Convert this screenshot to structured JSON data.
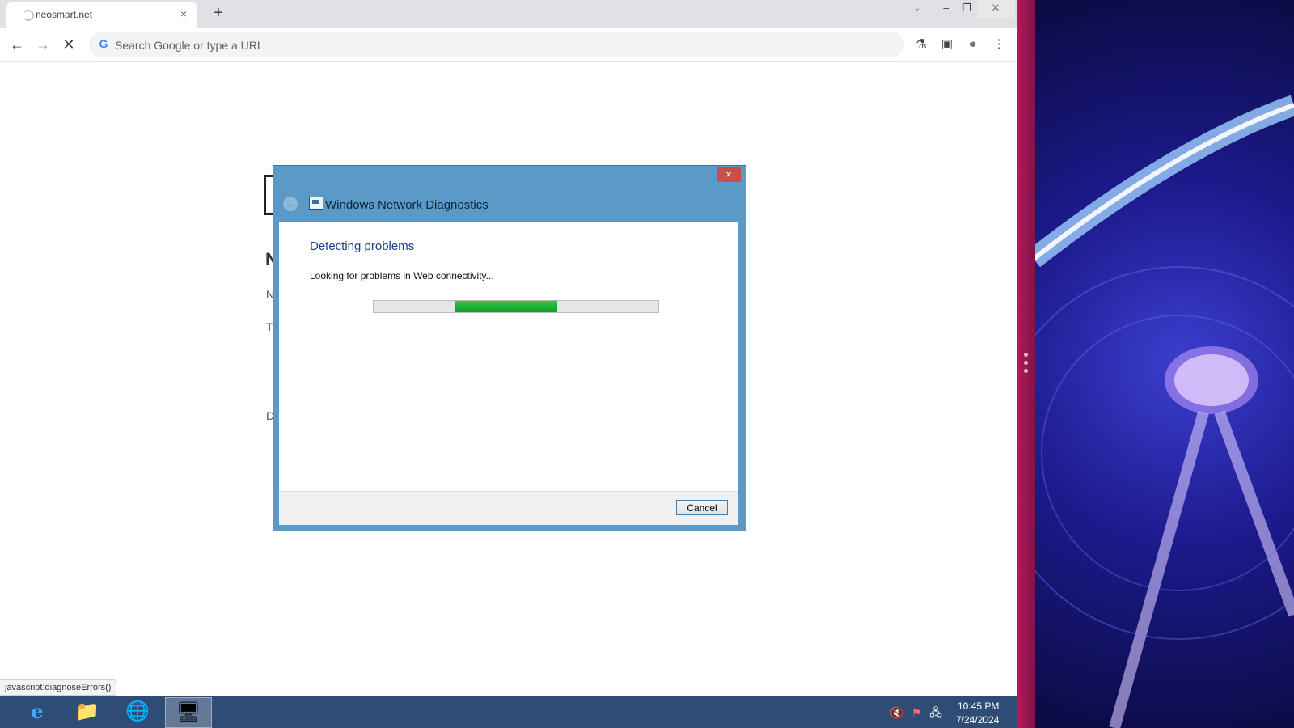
{
  "browser": {
    "tab": {
      "title": "neosmart.net",
      "close_icon": "×"
    },
    "new_tab": "+",
    "window_controls": {
      "tab_list": "⌄",
      "minimize": "–",
      "restore": "❐",
      "close": "✕"
    },
    "nav": {
      "back": "←",
      "forward": "→",
      "stop": "✕"
    },
    "omnibox": {
      "placeholder": "Search Google or type a URL",
      "g_icon": "G"
    },
    "toolbar_icons": {
      "labs": "⚗",
      "side_panel": "▣",
      "profile": "●",
      "menu": "⋮"
    },
    "status_bubble": "javascript:diagnoseErrors()",
    "page_fragments": [
      "N",
      "N",
      "T",
      "D"
    ]
  },
  "dialog": {
    "title": "Windows Network Diagnostics",
    "close_icon": "×",
    "back_icon": "←",
    "heading": "Detecting problems",
    "status": "Looking for problems in Web connectivity...",
    "progress_position": "indeterminate (marquee)",
    "cancel_label": "Cancel"
  },
  "taskbar": {
    "apps": [
      {
        "name": "Internet Explorer",
        "icon": "internet-explorer-icon",
        "glyph": "e"
      },
      {
        "name": "File Explorer",
        "icon": "folder-icon",
        "glyph": "📁"
      },
      {
        "name": "Network",
        "icon": "globe-icon",
        "glyph": "🌐"
      },
      {
        "name": "Network Diagnostics",
        "icon": "diagnostics-icon",
        "glyph": "🖥"
      }
    ],
    "tray": {
      "volume": "🔇",
      "flag": "⚑",
      "network": "🖧"
    },
    "clock": {
      "time": "10:45 PM",
      "date": "7/24/2024"
    }
  },
  "colors": {
    "dialog_frame": "#5b99c6",
    "progress_green": "#06a12a",
    "heading_blue": "#1a3e8c",
    "taskbar": "#2f4c76",
    "desktop_accent": "#b11a5d"
  }
}
